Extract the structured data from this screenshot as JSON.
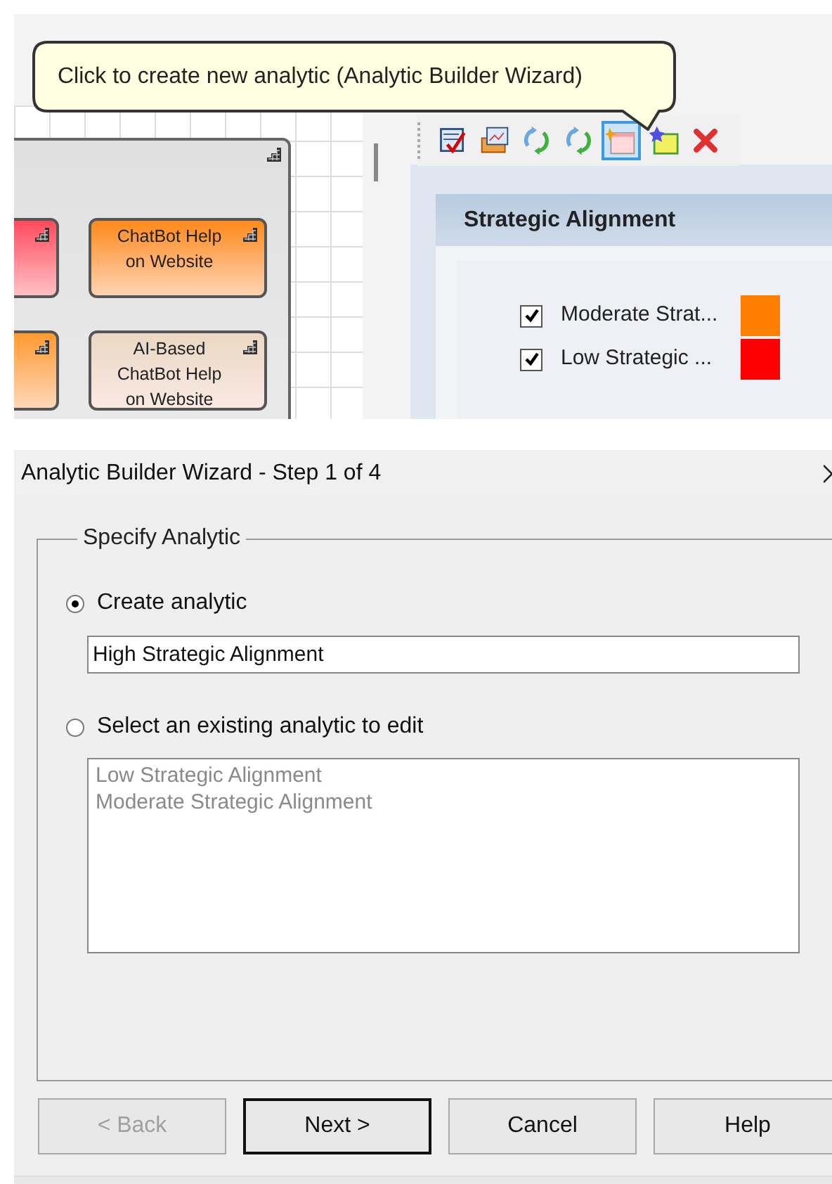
{
  "tooltip": {
    "text": "Click to create new analytic (Analytic Builder Wizard)"
  },
  "diagram": {
    "nodes": [
      {
        "kind": "partial",
        "color": "#ff4b5c"
      },
      {
        "kind": "full",
        "label": "ChatBot Help on Website",
        "color": "#ff8a1c"
      },
      {
        "kind": "partial",
        "color": "#ff9a30"
      },
      {
        "kind": "full",
        "label": "AI-Based ChatBot Help on Website",
        "color": "#ead8c4"
      }
    ]
  },
  "toolbar": {
    "buttons": [
      {
        "kind": "checklist",
        "selected": false
      },
      {
        "kind": "open",
        "selected": false
      },
      {
        "kind": "refresh",
        "selected": false
      },
      {
        "kind": "refresh",
        "selected": false
      },
      {
        "kind": "new",
        "selected": true
      },
      {
        "kind": "new-star",
        "selected": false
      },
      {
        "kind": "delete",
        "selected": false
      }
    ]
  },
  "legend_panel": {
    "title": "Strategic Alignment",
    "items": [
      {
        "label": "Moderate Strat...",
        "checked": true,
        "color": "#ff8000"
      },
      {
        "label": "Low Strategic ...",
        "checked": true,
        "color": "#ff0000"
      }
    ]
  },
  "dialog": {
    "title": "Analytic Builder Wizard - Step 1 of 4",
    "group": "Specify Analytic",
    "options": [
      {
        "label": "Create analytic",
        "selected": true
      },
      {
        "label": "Select an existing analytic to edit",
        "selected": false
      }
    ],
    "name_field": {
      "value": "High Strategic Alignment"
    },
    "existing_list": {
      "disabled": true,
      "items": [
        "Low Strategic Alignment",
        "Moderate Strategic Alignment"
      ]
    },
    "buttons": [
      {
        "label": "< Back",
        "disabled": true,
        "default": false
      },
      {
        "label": "Next >",
        "disabled": false,
        "default": true
      },
      {
        "label": "Cancel",
        "disabled": false,
        "default": false
      },
      {
        "label": "Help",
        "disabled": false,
        "default": false
      }
    ]
  }
}
